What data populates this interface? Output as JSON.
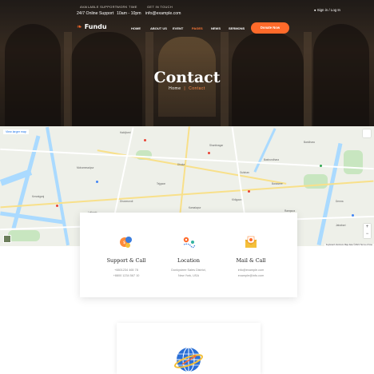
{
  "topbar": {
    "support_label": "Available Support",
    "support_value": "24/7 Online Support",
    "work_label": "Work Time",
    "work_value": "10am - 10pm",
    "touch_label": "Get in Touch",
    "touch_value": "info@example.com",
    "login": "Sign in / Log In"
  },
  "nav": {
    "logo": "Fundu",
    "items": [
      "Home",
      "About Us",
      "Event",
      "Pages",
      "News",
      "Sermons"
    ],
    "active_index": 3,
    "donate": "Donate Now"
  },
  "hero": {
    "title": "Contact",
    "crumb_home": "Home",
    "crumb_sep": "|",
    "crumb_current": "Contact"
  },
  "map": {
    "view_link": "View larger map",
    "footer": "Keyboard shortcuts   Map data ©2021   Terms of Use",
    "zoom_in": "+",
    "zoom_out": "−",
    "labels": {
      "hatirjheel": "Hatirjheel",
      "baridhara": "Baridhara",
      "dhaka": "Dhaka",
      "mohammadpur": "Mohammadpur",
      "shantinagar": "Shantinagar",
      "bashundhara": "Bashundhara",
      "banasree": "Banasree",
      "demra": "Demra",
      "tejgaon": "Tejgaon",
      "dhanmondi": "Dhanmondi",
      "khilgaon": "Khilgaon",
      "gulshan": "Gulshan",
      "rampura": "Rampura",
      "lalbagh": "Lalbagh",
      "kamalapur": "Kamalapur",
      "keraniganj": "Keraniganj",
      "jatrabari": "Jatrabari"
    }
  },
  "contact": [
    {
      "title": "Support & Call",
      "line1": "+8801234 465 78",
      "line2": "+8800 1234 567 10"
    },
    {
      "title": "Location",
      "line1": "Donkystree Sales District,",
      "line2": "New York, USA"
    },
    {
      "title": "Mail & Call",
      "line1": "info@example.com",
      "line2": "example@info.com"
    }
  ],
  "colors": {
    "accent": "#ff6a2a",
    "hero_dark": "#2a2420",
    "card_bg": "#ffffff",
    "map_water": "#aadaff"
  },
  "icons": {
    "support": "support-headset-icon",
    "location": "map-location-icon",
    "mail": "envelope-icon",
    "globe": "globe-icon"
  }
}
